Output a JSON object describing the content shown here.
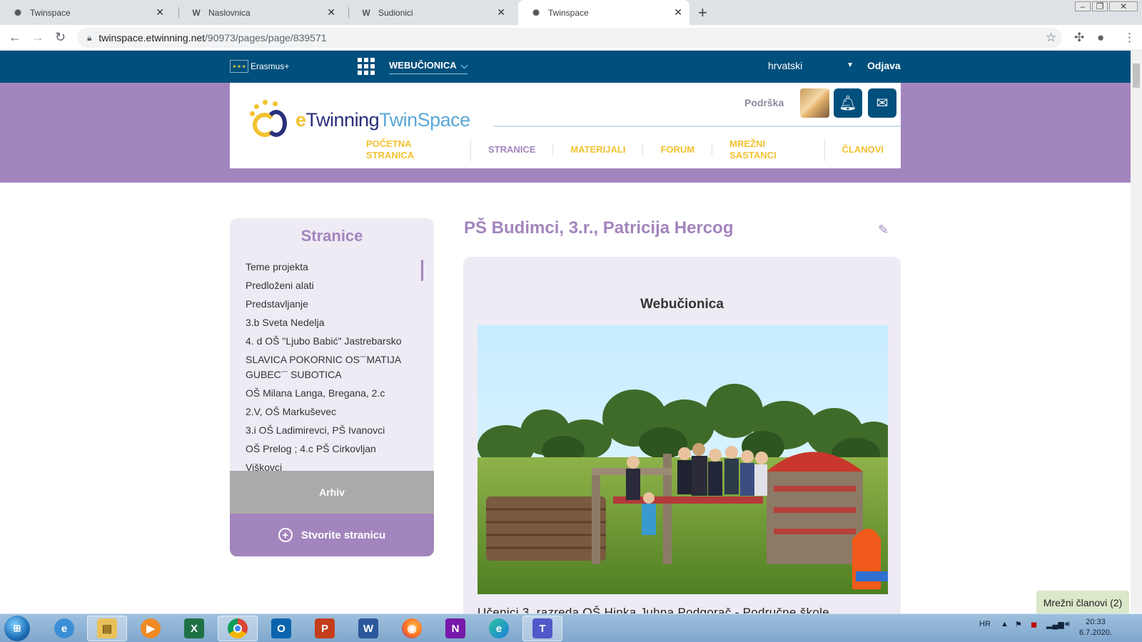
{
  "browser": {
    "tabs": [
      {
        "label": "Twinspace",
        "icon": "twinspace-favicon"
      },
      {
        "label": "Naslovnica",
        "icon": "w-favicon"
      },
      {
        "label": "Sudionici",
        "icon": "w-favicon"
      },
      {
        "label": "Twinspace",
        "icon": "twinspace-favicon",
        "active": true
      }
    ],
    "url_host": "twinspace.etwinning.net",
    "url_path": "/90973/pages/page/839571"
  },
  "site": {
    "erasmus_label": "Erasmus+",
    "space_name": "WEBUČIONICA",
    "language": "hrvatski",
    "logout": "Odjava",
    "support": "Podrška",
    "logo_e": "e",
    "logo_twinning": "Twinning",
    "logo_twinspace": "TwinSpace",
    "nav": [
      {
        "label": "POČETNA STRANICA",
        "active": false
      },
      {
        "label": "STRANICE",
        "active": true
      },
      {
        "label": "MATERIJALI",
        "active": false
      },
      {
        "label": "FORUM",
        "active": false
      },
      {
        "label": "MREŽNI SASTANCI",
        "active": false
      },
      {
        "label": "ČLANOVI",
        "active": false
      }
    ]
  },
  "sidebar": {
    "title": "Stranice",
    "items": [
      "Teme projekta",
      "Predloženi alati",
      "Predstavljanje",
      "3.b Sveta Nedelja",
      "4. d OŠ \"Ljubo Babić\" Jastrebarsko",
      "SLAVICA POKORNIC OS¨¨MATIJA GUBEC¨¨ SUBOTICA",
      "OŠ Milana Langa, Bregana, 2.c",
      "2.V, OŠ Markuševec",
      "3.i OŠ Ladimirevci, PŠ Ivanovci",
      "OŠ Prelog ; 4.c PŠ Cirkovljan",
      "Viškovci"
    ],
    "archive": "Arhiv",
    "create_page": "Stvorite stranicu"
  },
  "content": {
    "page_title": "PŠ Budimci, 3.r., Patricija Hercog",
    "card_title": "Webučionica",
    "body_text": "Učenici 3. razreda OŠ Hinka Juhna Podgorač - Područne škole"
  },
  "online_members": "Mrežni članovi (2)",
  "taskbar": {
    "apps": [
      "internet-explorer",
      "file-explorer",
      "media-player",
      "excel",
      "chrome",
      "outlook",
      "powerpoint",
      "word",
      "firefox",
      "onenote",
      "edge",
      "teams"
    ],
    "lang": "HR",
    "time": "20:33",
    "date": "6.7.2020."
  },
  "colors": {
    "site_blue": "#004f7c",
    "purple": "#a385bd",
    "yellow": "#f2c230",
    "sidebar_bg": "#efebf4"
  }
}
